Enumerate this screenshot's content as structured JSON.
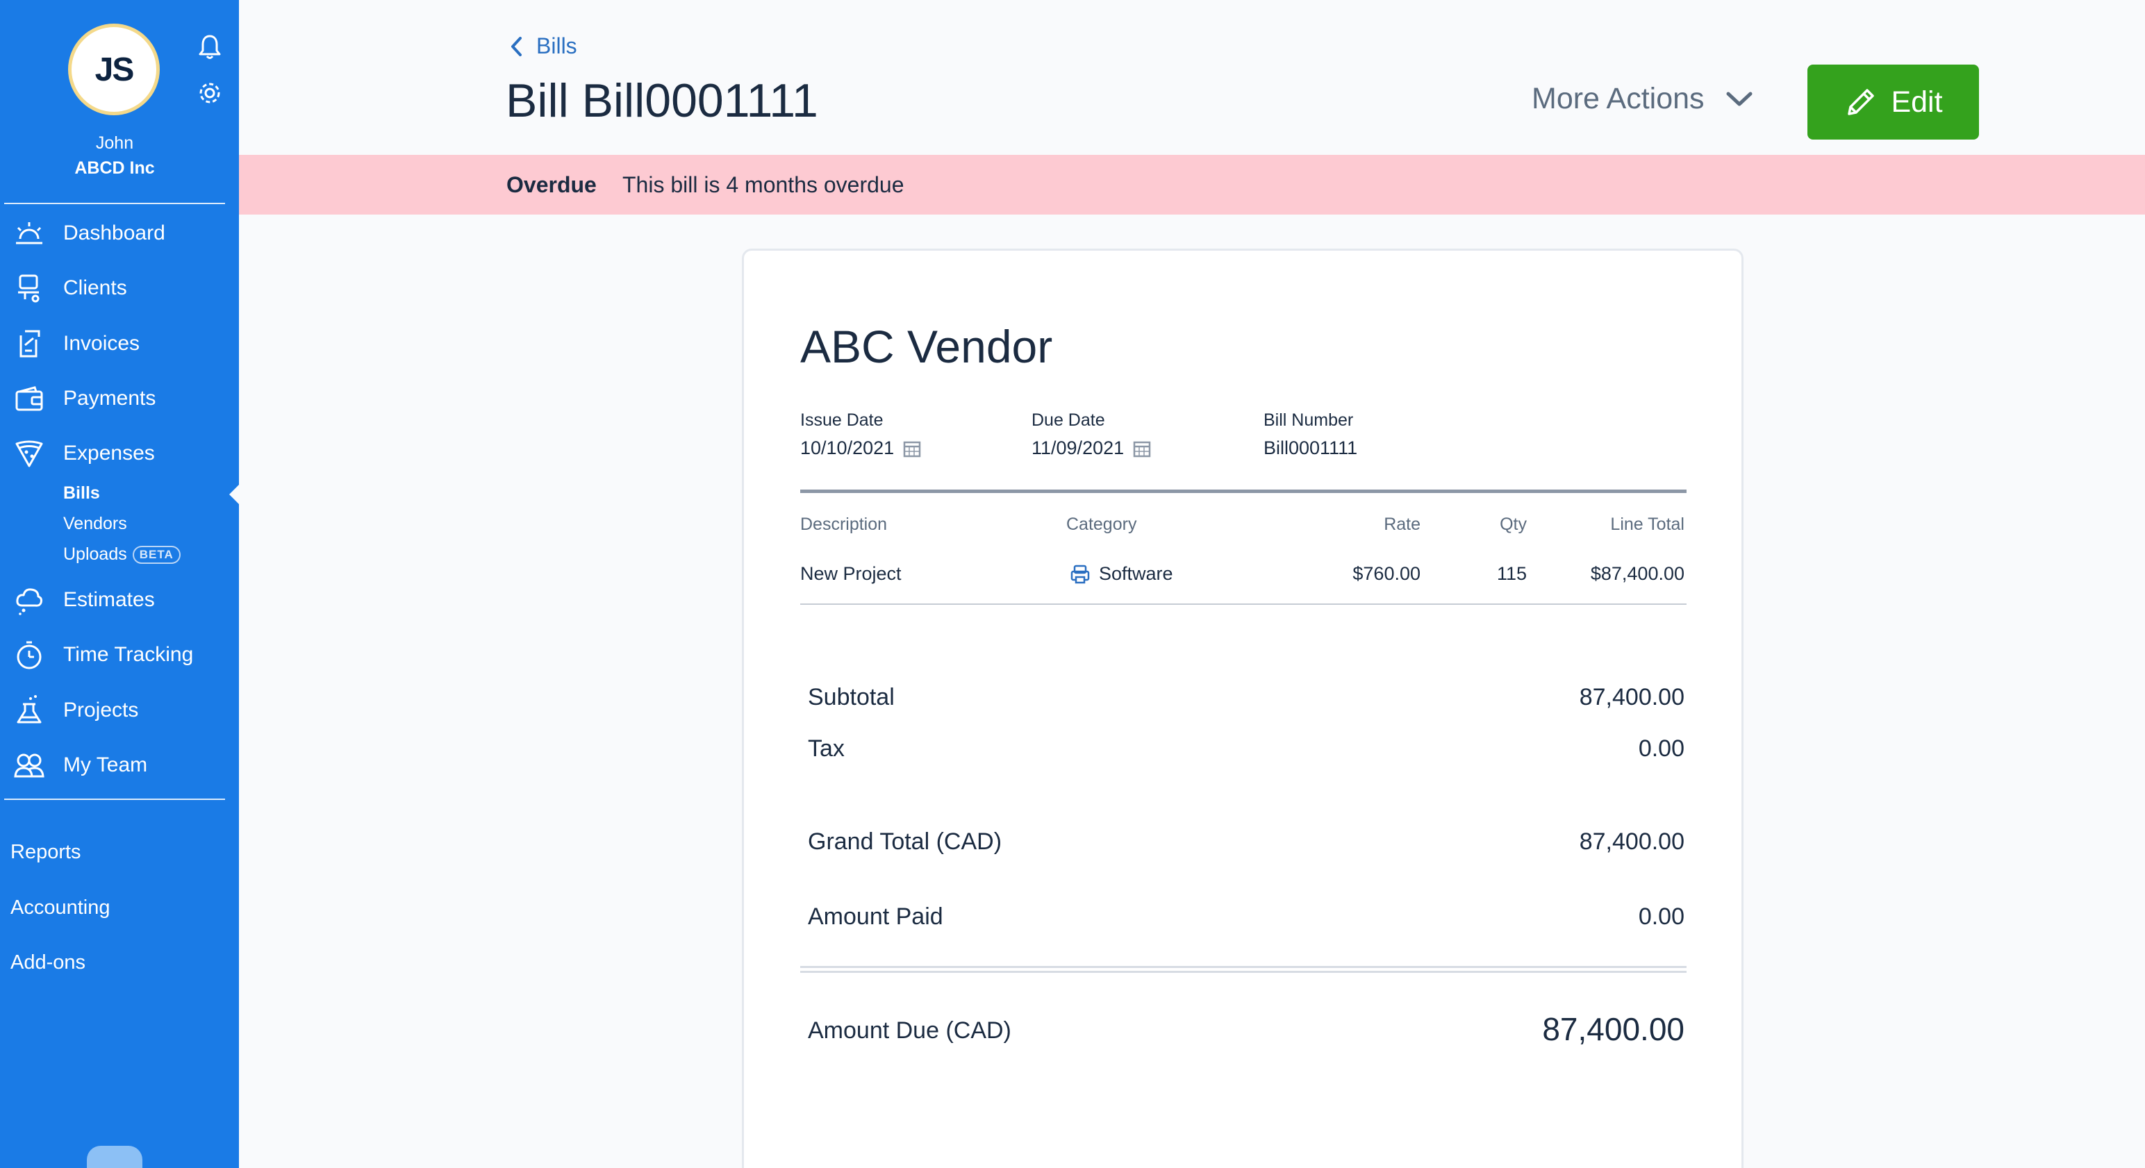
{
  "user": {
    "initials": "JS",
    "name": "John",
    "company": "ABCD Inc"
  },
  "nav": {
    "items": [
      {
        "label": "Dashboard",
        "icon": "sun-icon"
      },
      {
        "label": "Clients",
        "icon": "client-icon"
      },
      {
        "label": "Invoices",
        "icon": "invoice-icon"
      },
      {
        "label": "Payments",
        "icon": "wallet-icon"
      },
      {
        "label": "Expenses",
        "icon": "pizza-icon"
      }
    ],
    "sub_items": [
      {
        "label": "Bills",
        "active": true
      },
      {
        "label": "Vendors"
      },
      {
        "label": "Uploads",
        "badge": "BETA"
      }
    ],
    "items2": [
      {
        "label": "Estimates",
        "icon": "cloud-icon"
      },
      {
        "label": "Time Tracking",
        "icon": "stopwatch-icon"
      },
      {
        "label": "Projects",
        "icon": "flask-icon"
      },
      {
        "label": "My Team",
        "icon": "team-icon"
      }
    ],
    "plain": [
      "Reports",
      "Accounting",
      "Add-ons"
    ]
  },
  "header": {
    "breadcrumb": "Bills",
    "title": "Bill Bill0001111",
    "more_actions": "More Actions",
    "edit": "Edit"
  },
  "banner": {
    "status": "Overdue",
    "message": "This bill is 4 months overdue"
  },
  "bill": {
    "vendor": "ABC Vendor",
    "issue_date_label": "Issue Date",
    "issue_date": "10/10/2021",
    "due_date_label": "Due Date",
    "due_date": "11/09/2021",
    "bill_number_label": "Bill Number",
    "bill_number": "Bill0001111",
    "columns": [
      "Description",
      "Category",
      "Rate",
      "Qty",
      "Line Total"
    ],
    "lines": [
      {
        "description": "New Project",
        "category": "Software",
        "rate": "$760.00",
        "qty": "115",
        "total": "$87,400.00"
      }
    ],
    "totals": {
      "subtotal_label": "Subtotal",
      "subtotal": "87,400.00",
      "tax_label": "Tax",
      "tax": "0.00",
      "grand_total_label": "Grand Total (CAD)",
      "grand_total": "87,400.00",
      "paid_label": "Amount Paid",
      "paid": "0.00",
      "due_label": "Amount Due (CAD)",
      "due": "87,400.00"
    }
  },
  "colors": {
    "sidebar": "#1a7be6",
    "edit_button": "#34a21d",
    "banner": "#fdcad2"
  }
}
